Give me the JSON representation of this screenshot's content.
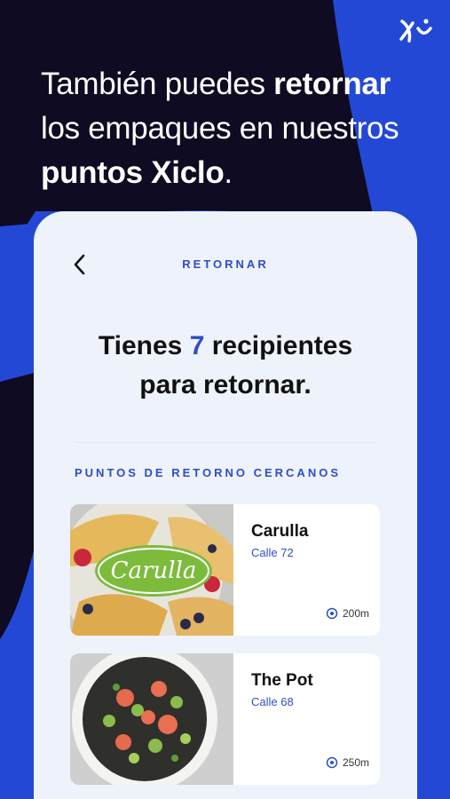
{
  "headline": {
    "part1": "También puedes ",
    "bold1": "retornar",
    "part2": " los empaques en nuestros ",
    "bold2": "puntos Xiclo",
    "part3": "."
  },
  "screen": {
    "title": "RETORNAR",
    "count_prefix": "Tienes ",
    "count_value": "7",
    "count_suffix": " recipientes",
    "count_line2": "para retornar."
  },
  "section_label": "PUNTOS DE RETORNO CERCANOS",
  "points": [
    {
      "name": "Carulla",
      "address": "Calle 72",
      "distance": "200m",
      "logo_text": "Carulla"
    },
    {
      "name": "The Pot",
      "address": "Calle 68",
      "distance": "250m"
    }
  ],
  "colors": {
    "background": "#0e0b22",
    "accent_blue": "#2448d6",
    "card_bg": "#eef2fb",
    "text_blue": "#2d4fc4",
    "carulla_green": "#7dbb3c"
  },
  "icons": {
    "back": "chevron-left-icon",
    "location": "location-pin-icon",
    "brand": "xiclo-logo"
  }
}
